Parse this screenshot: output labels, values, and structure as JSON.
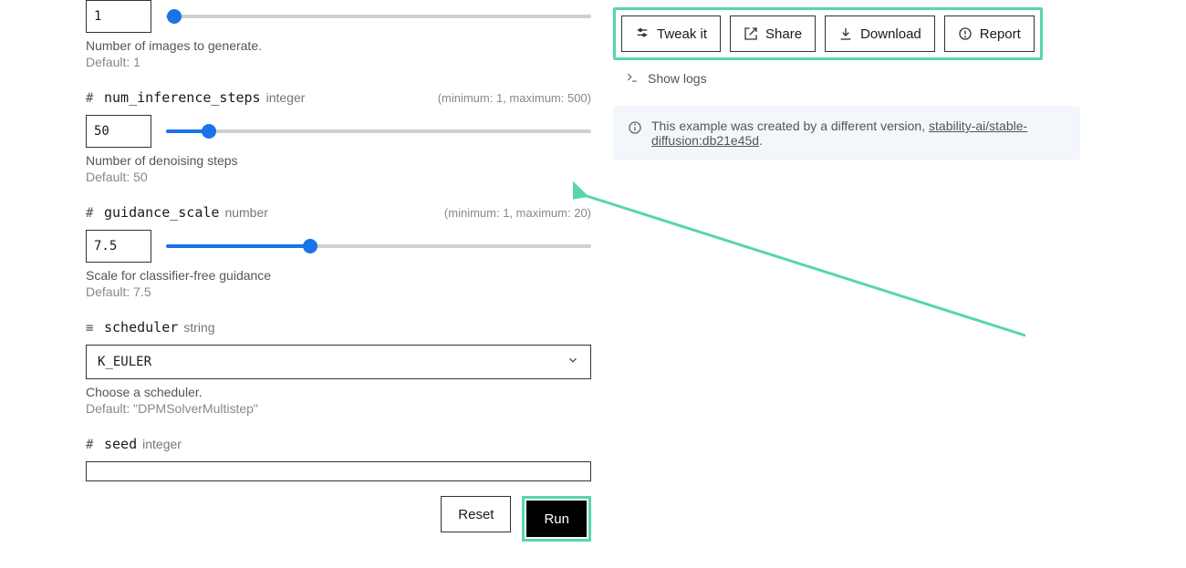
{
  "left": {
    "num_outputs": {
      "value": "1",
      "slider_percent": 0,
      "hint": "Number of images to generate.",
      "default": "Default: 1"
    },
    "num_inference_steps": {
      "prefix": "#",
      "name": "num_inference_steps",
      "type": "integer",
      "range": "(minimum: 1, maximum: 500)",
      "value": "50",
      "slider_percent": 10,
      "hint": "Number of denoising steps",
      "default": "Default: 50"
    },
    "guidance_scale": {
      "prefix": "#",
      "name": "guidance_scale",
      "type": "number",
      "range": "(minimum: 1, maximum: 20)",
      "value": "7.5",
      "slider_percent": 34,
      "hint": "Scale for classifier-free guidance",
      "default": "Default: 7.5"
    },
    "scheduler": {
      "prefix": "≡",
      "name": "scheduler",
      "type": "string",
      "value": "K_EULER",
      "hint": "Choose a scheduler.",
      "default": "Default: \"DPMSolverMultistep\""
    },
    "seed": {
      "prefix": "#",
      "name": "seed",
      "type": "integer"
    },
    "buttons": {
      "reset": "Reset",
      "run": "Run"
    }
  },
  "right": {
    "toolbar": {
      "tweak": "Tweak it",
      "share": "Share",
      "download": "Download",
      "report": "Report"
    },
    "show_logs": "Show logs",
    "notice_text": "This example was created by a different version, ",
    "notice_link": "stability-ai/stable-diffusion:db21e45d",
    "notice_suffix": "."
  }
}
